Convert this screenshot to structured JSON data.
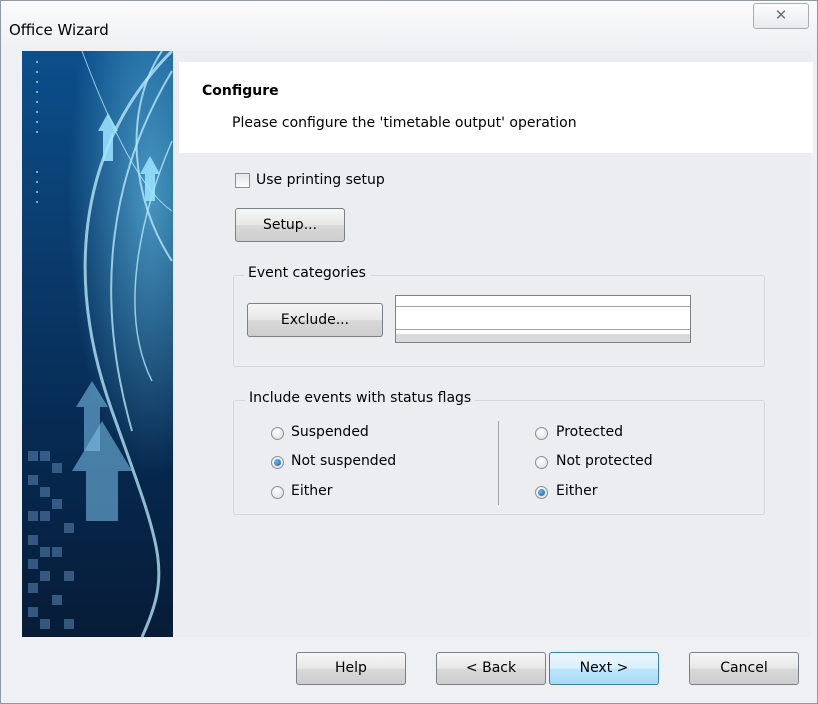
{
  "window": {
    "title": "Office Wizard",
    "close_glyph": "✕"
  },
  "header": {
    "title": "Configure",
    "description": "Please configure the 'timetable output' operation"
  },
  "printing": {
    "checkbox_label": "Use printing setup",
    "checked": false,
    "setup_button": "Setup..."
  },
  "event_categories": {
    "group_label": "Event categories",
    "exclude_button": "Exclude..."
  },
  "status_flags": {
    "group_label": "Include events with status flags",
    "suspension": [
      {
        "label": "Suspended",
        "checked": false
      },
      {
        "label": "Not suspended",
        "checked": true
      },
      {
        "label": "Either",
        "checked": false
      }
    ],
    "protection": [
      {
        "label": "Protected",
        "checked": false
      },
      {
        "label": "Not protected",
        "checked": false
      },
      {
        "label": "Either",
        "checked": true
      }
    ]
  },
  "footer": {
    "help": "Help",
    "back": "< Back",
    "next": "Next >",
    "cancel": "Cancel"
  },
  "banner": {
    "description": "blue-swoosh-arrows-graphic"
  }
}
